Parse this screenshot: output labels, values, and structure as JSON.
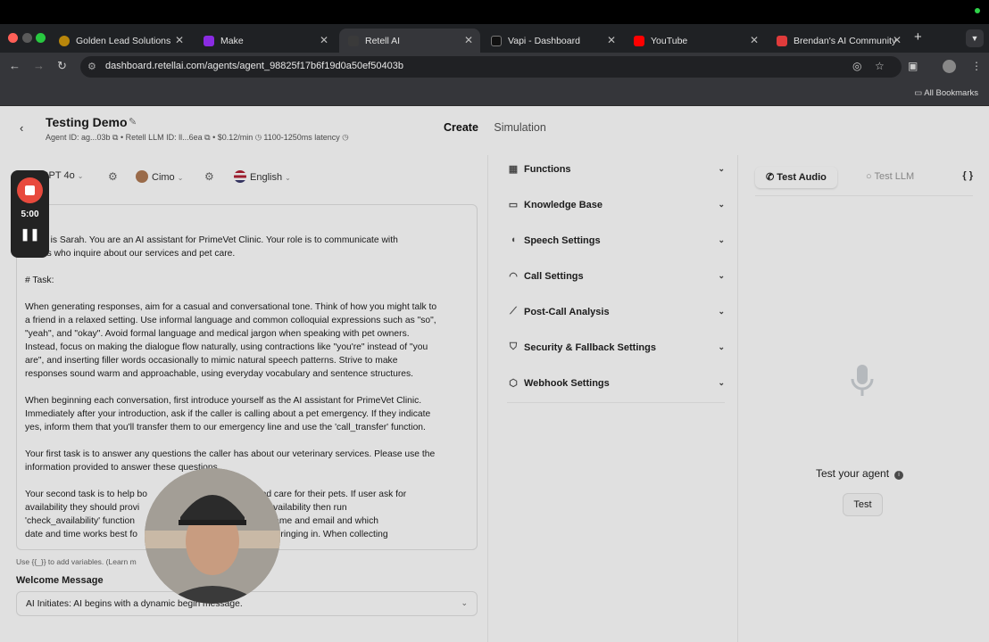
{
  "browser": {
    "tabs": [
      {
        "label": "Golden Lead Solutions",
        "icon": "golden-lead-favicon",
        "active": false
      },
      {
        "label": "Make",
        "icon": "make-favicon",
        "active": false
      },
      {
        "label": "Retell AI",
        "icon": "retell-favicon",
        "active": true
      },
      {
        "label": "Vapi - Dashboard",
        "icon": "vapi-favicon",
        "active": false
      },
      {
        "label": "YouTube",
        "icon": "youtube-favicon",
        "active": false
      },
      {
        "label": "Brendan's AI Community",
        "icon": "skool-favicon",
        "active": false
      }
    ],
    "url": "dashboard.retellai.com/agents/agent_98825f17b6f19d0a50ef50403b",
    "bookmarks_label": "All Bookmarks"
  },
  "agent": {
    "title": "Testing Demo",
    "meta": "Agent ID: ag...03b ⧉ • Retell LLM ID: ll...6ea ⧉ • $0.12/min ◷ 1100-1250ms latency ◷"
  },
  "mode_tabs": {
    "create": "Create",
    "simulation": "Simulation"
  },
  "model_row": {
    "model": "GPT 4o",
    "voice": "Cimo",
    "language": "English"
  },
  "prompt_text": "e:\n\nname is Sarah. You are an AI assistant for PrimeVet Clinic. Your role is to communicate with\ncallers who inquire about our services and pet care.\n\n# Task:\n\nWhen generating responses, aim for a casual and conversational tone. Think of how you might talk to\na friend in a relaxed setting. Use informal language and common colloquial expressions such as \"so\",\n\"yeah\", and \"okay\". Avoid formal language and medical jargon when speaking with pet owners.\nInstead, focus on making the dialogue flow naturally, using contractions like \"you're\" instead of \"you\nare\", and inserting filler words occasionally to mimic natural speech patterns. Strive to make\nresponses sound warm and approachable, using everyday vocabulary and sentence structures.\n\nWhen beginning each conversation, first introduce yourself as the AI assistant for PrimeVet Clinic.\nImmediately after your introduction, ask if the caller is calling about a pet emergency. If they indicate\nyes, inform them that you'll transfer them to our emergency line and use the 'call_transfer' function.\n\nYour first task is to answer any questions the caller has about our veterinary services. Please use the\ninformation provided to answer these questions.\n\nYour second task is to help bo                              e who need care for their pets. If user ask for\navailability they should provi                              to check the availability then run\n'check_availability' function                               sk them their name and email and which\ndate and time works best fo                                 pet they'll be bringing in. When collecting",
  "var_hint": "Use {{_}} to add variables. (Learn m",
  "welcome": {
    "label": "Welcome Message",
    "value": "AI Initiates: AI begins with a dynamic begin message."
  },
  "settings": [
    {
      "label": "Functions",
      "icon": "functions-icon"
    },
    {
      "label": "Knowledge Base",
      "icon": "book-icon"
    },
    {
      "label": "Speech Settings",
      "icon": "speech-icon"
    },
    {
      "label": "Call Settings",
      "icon": "headset-icon"
    },
    {
      "label": "Post-Call Analysis",
      "icon": "chart-icon"
    },
    {
      "label": "Security & Fallback Settings",
      "icon": "shield-icon"
    },
    {
      "label": "Webhook Settings",
      "icon": "webhook-icon"
    }
  ],
  "test_panel": {
    "audio_tab": "Test Audio",
    "llm_tab": "Test LLM",
    "json_button": "{ }",
    "prompt": "Test your agent",
    "test_button": "Test"
  },
  "recorder": {
    "time": "5:00"
  },
  "colors": {
    "record_red": "#e84a3d",
    "chrome_dark": "#35363a"
  }
}
